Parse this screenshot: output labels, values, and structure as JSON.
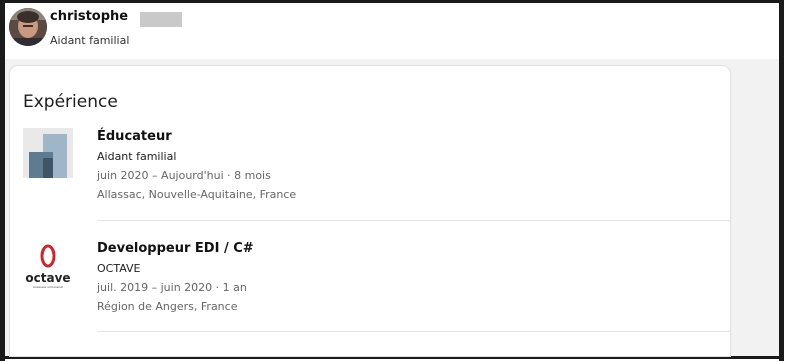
{
  "profile": {
    "name": "christophe",
    "headline": "Aidant familial"
  },
  "experience": {
    "section_title": "Expérience",
    "items": [
      {
        "title": "Éducateur",
        "company": "Aidant familial",
        "dates": "juin 2020 – Aujourd'hui · 8 mois",
        "location": "Allassac, Nouvelle-Aquitaine, France",
        "logo_icon": "company-placeholder-icon"
      },
      {
        "title": "Developpeur EDI / C#",
        "company": "OCTAVE",
        "dates": "juil. 2019 – juin 2020 · 1 an",
        "location": "Région de Angers, France",
        "logo_icon": "octave-logo",
        "logo_text": "octave",
        "logo_subtext": "business omnicanal"
      }
    ]
  },
  "colors": {
    "logo_placeholder_light": "#9fb6c9",
    "logo_placeholder_mid": "#5f7b92",
    "logo_placeholder_dark": "#3f5466",
    "octave_red": "#d1242a"
  }
}
